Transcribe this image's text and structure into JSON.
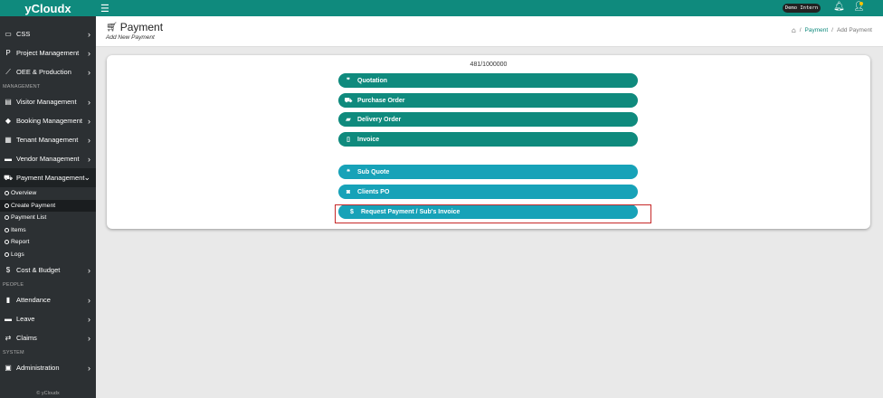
{
  "app": {
    "brand": "yCloudx"
  },
  "sidebar": {
    "items_top": [
      {
        "label": "CSS",
        "icon": "monitor-icon"
      },
      {
        "label": "Project Management",
        "icon": "p-icon"
      },
      {
        "label": "OEE & Production",
        "icon": "chart-icon"
      }
    ],
    "sections": [
      "MANAGEMENT",
      "PEOPLE",
      "SYSTEM"
    ],
    "items_mgmt": [
      {
        "label": "Visitor Management",
        "icon": "id-card-icon"
      },
      {
        "label": "Booking Management",
        "icon": "tag-icon"
      },
      {
        "label": "Tenant Management",
        "icon": "building-icon"
      },
      {
        "label": "Vendor Management",
        "icon": "vendor-icon"
      },
      {
        "label": "Payment Management",
        "icon": "cart-icon"
      }
    ],
    "payment_sub": [
      {
        "label": "Overview"
      },
      {
        "label": "Create Payment"
      },
      {
        "label": "Payment List"
      },
      {
        "label": "Items"
      },
      {
        "label": "Report"
      },
      {
        "label": "Logs"
      }
    ],
    "cost": {
      "label": "Cost & Budget"
    },
    "items_people": [
      {
        "label": "Attendance"
      },
      {
        "label": "Leave"
      },
      {
        "label": "Claims"
      }
    ],
    "items_system": [
      {
        "label": "Administration"
      }
    ],
    "footer": "© yCloudx"
  },
  "topbar": {
    "user_badge": "Demo Intern"
  },
  "header": {
    "title": "Payment",
    "subtitle": "Add New Payment",
    "breadcrumb": [
      "Payment",
      "Add Payment"
    ]
  },
  "card": {
    "counter": "481/1000000",
    "buttons_green": [
      {
        "label": "Quotation",
        "icon": "quote-icon"
      },
      {
        "label": "Purchase Order",
        "icon": "cart-icon"
      },
      {
        "label": "Delivery Order",
        "icon": "truck-icon"
      },
      {
        "label": "Invoice",
        "icon": "file-icon"
      }
    ],
    "buttons_blue": [
      {
        "label": "Sub Quote",
        "icon": "quote-icon"
      },
      {
        "label": "Clients PO",
        "icon": "money-icon"
      },
      {
        "label": "Request Payment / Sub's Invoice",
        "icon": "dollar-icon"
      }
    ]
  },
  "colors": {
    "brand": "#0f8a7d",
    "blue": "#17a2b8",
    "sidebar": "#2c3033",
    "highlight": "#c62828"
  }
}
